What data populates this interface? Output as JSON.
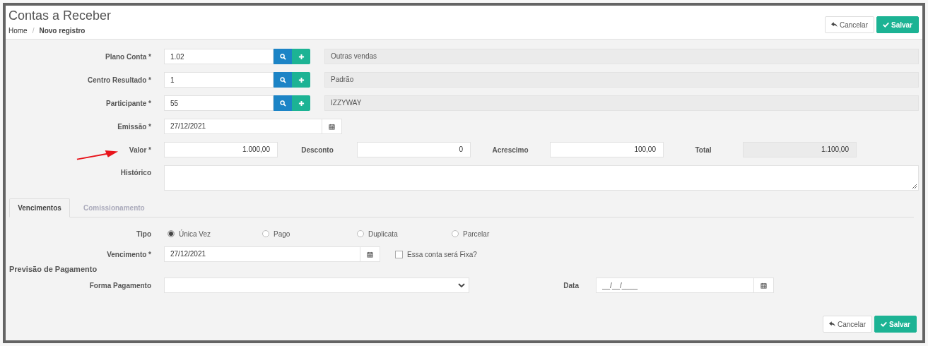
{
  "header": {
    "title": "Contas a Receber",
    "breadcrumb": [
      {
        "label": "Home",
        "current": false
      },
      {
        "label": "Novo registro",
        "current": true
      }
    ],
    "separator": "/",
    "actions": [
      {
        "kind": "cancel",
        "label": "Cancelar"
      },
      {
        "kind": "save",
        "label": "Salvar"
      }
    ]
  },
  "lookups": [
    {
      "label": "Plano Conta *",
      "value": "1.02",
      "description": "Outras vendas"
    },
    {
      "label": "Centro Resultado *",
      "value": "1",
      "description": "Padrão"
    },
    {
      "label": "Participante *",
      "value": "55",
      "description": "IZZYWAY"
    }
  ],
  "emissao": {
    "label": "Emissão *",
    "value": "27/12/2021"
  },
  "amounts": [
    {
      "label": "Valor *",
      "value": "1.000,00",
      "readonly": false
    },
    {
      "label": "Desconto",
      "value": "0",
      "readonly": false
    },
    {
      "label": "Acrescimo",
      "value": "100,00",
      "readonly": false
    },
    {
      "label": "Total",
      "value": "1.100,00",
      "readonly": true
    }
  ],
  "historico": {
    "label": "Histórico"
  },
  "tabs": [
    {
      "label": "Vencimentos",
      "selected": true
    },
    {
      "label": "Comissionamento",
      "selected": false
    }
  ],
  "tipo": {
    "label": "Tipo",
    "options": [
      {
        "label": "Única Vez",
        "selected": true
      },
      {
        "label": "Pago",
        "selected": false
      },
      {
        "label": "Duplicata",
        "selected": false
      },
      {
        "label": "Parcelar",
        "selected": false
      }
    ]
  },
  "vencimento": {
    "label": "Vencimento *",
    "value": "27/12/2021",
    "checkbox": {
      "label": "Essa conta será Fixa?",
      "checked": false
    }
  },
  "previsao": {
    "title": "Previsão de Pagamento",
    "forma": {
      "label": "Forma Pagamento"
    },
    "data": {
      "label": "Data",
      "placeholder": "__/__/____"
    }
  },
  "footer_actions": [
    {
      "kind": "cancel",
      "label": "Cancelar"
    },
    {
      "kind": "save",
      "label": "Salvar"
    }
  ]
}
